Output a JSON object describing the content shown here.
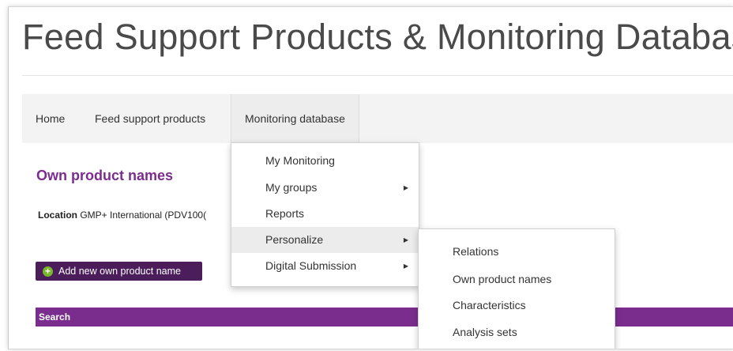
{
  "header": {
    "title": "Feed Support Products & Monitoring Database"
  },
  "nav": {
    "items": [
      {
        "label": "Home"
      },
      {
        "label": "Feed support products"
      },
      {
        "label": "Monitoring database"
      }
    ]
  },
  "page": {
    "section_title": "Own product names",
    "location_label": "Location",
    "location_value": "GMP+ International (PDV100(",
    "add_button_label": "Add new own product name",
    "search_label": "Search"
  },
  "menu": {
    "items": [
      {
        "label": "My Monitoring",
        "has_submenu": false
      },
      {
        "label": "My groups",
        "has_submenu": true
      },
      {
        "label": "Reports",
        "has_submenu": false
      },
      {
        "label": "Personalize",
        "has_submenu": true,
        "highlighted": true
      },
      {
        "label": "Digital Submission",
        "has_submenu": true
      }
    ]
  },
  "submenu": {
    "items": [
      {
        "label": "Relations"
      },
      {
        "label": "Own product names"
      },
      {
        "label": "Characteristics"
      },
      {
        "label": "Analysis sets"
      }
    ]
  },
  "icons": {
    "add": "plus-circle-icon",
    "submenu": "caret-right-icon"
  },
  "colors": {
    "brand_purple": "#7b2d8e",
    "button_dark_purple": "#4b1e5b",
    "plus_green": "#76b82a"
  }
}
